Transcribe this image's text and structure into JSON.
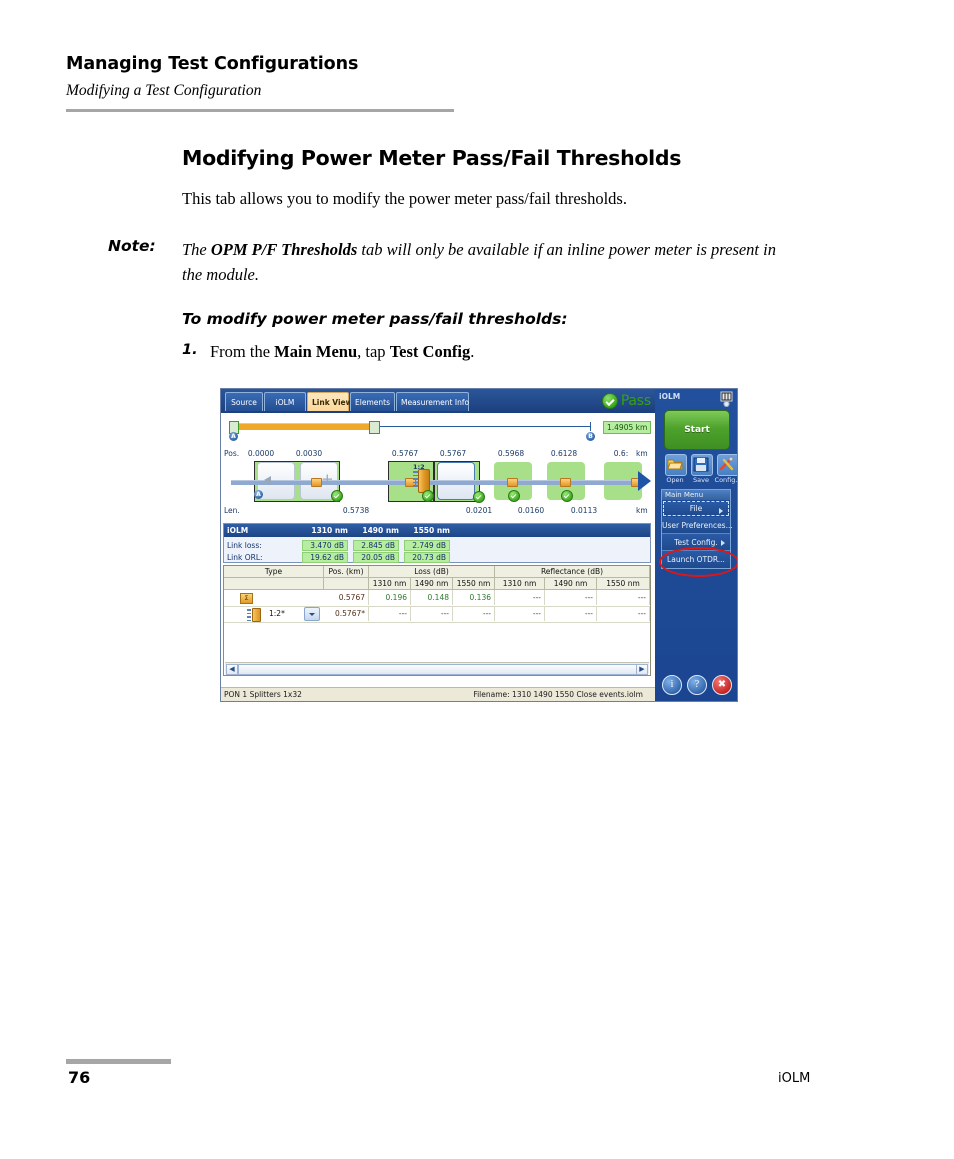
{
  "page": {
    "header_title": "Managing Test Configurations",
    "header_subtitle": "Modifying a Test Configuration",
    "section_title": "Modifying Power Meter Pass/Fail Thresholds",
    "intro_paragraph": "This tab allows you to modify the power meter pass/fail thresholds.",
    "note_label": "Note:",
    "note_text_pre": "The ",
    "note_text_bold": "OPM P/F Thresholds",
    "note_text_post": " tab will only be available if an inline power meter is present in the module.",
    "procedure_title": "To modify power meter pass/fail thresholds:",
    "step_number": "1.",
    "step_pre": "From the ",
    "step_bold1": "Main Menu",
    "step_mid": ", tap ",
    "step_bold2": "Test Config",
    "step_post": ".",
    "footer_page": "76",
    "footer_right": "iOLM"
  },
  "screenshot": {
    "tabs": [
      {
        "label": "Source",
        "active": false
      },
      {
        "label": "iOLM",
        "active": false
      },
      {
        "label": "Link View",
        "active": true
      },
      {
        "label": "Elements",
        "active": false
      },
      {
        "label": "Measurement Info",
        "active": false
      }
    ],
    "status": {
      "verdict": "Pass",
      "verdict_color": "#37a011"
    },
    "overview": {
      "distance_badge": "1.4905 km",
      "marker_a": "A",
      "marker_b": "B"
    },
    "linkview": {
      "pos_label": "Pos.",
      "len_label": "Len.",
      "unit_top": "km",
      "unit_bottom": "km",
      "positions": [
        "0.0000",
        "0.0030",
        "0.5767",
        "0.5767",
        "0.5968",
        "0.6128",
        "0.6:"
      ],
      "lengths": [
        "0.5738",
        "0.0201",
        "0.0160",
        "0.0113"
      ],
      "splitter_ratio": "1:2",
      "marker_a": "A"
    },
    "results": {
      "title": "iOLM",
      "wavelengths": [
        "1310 nm",
        "1490 nm",
        "1550 nm"
      ],
      "rows": [
        {
          "label": "Link loss:",
          "values": [
            "3.470 dB",
            "2.845 dB",
            "2.749 dB"
          ]
        },
        {
          "label": "Link ORL:",
          "values": [
            "19.62 dB",
            "20.05 dB",
            "20.73 dB"
          ]
        }
      ]
    },
    "table": {
      "group_headers": [
        "Type",
        "Pos. (km)",
        "Loss (dB)",
        "Reflectance (dB)"
      ],
      "sub_headers": [
        "1310 nm",
        "1490 nm",
        "1550 nm",
        "1310 nm",
        "1490 nm",
        "1550 nm"
      ],
      "rows": [
        {
          "icon": "event-icon",
          "type_label": "",
          "pos": "0.5767",
          "loss": [
            "0.196",
            "0.148",
            "0.136"
          ],
          "reflectance": [
            "---",
            "---",
            "---"
          ]
        },
        {
          "icon": "splitter-icon",
          "type_label": "1:2*",
          "pos": "0.5767*",
          "loss": [
            "---",
            "---",
            "---"
          ],
          "reflectance": [
            "---",
            "---",
            "---"
          ]
        }
      ],
      "scroll_left": "◀",
      "scroll_right": "▶"
    },
    "statusbar": {
      "left": "PON 1 Splitters 1x32",
      "right": "Filename: 1310 1490 1550 Close events.iolm"
    },
    "panel": {
      "title": "iOLM",
      "start_button": "Start",
      "tools": [
        {
          "label": "Open",
          "icon": "folder-open-icon"
        },
        {
          "label": "Save",
          "icon": "floppy-disk-icon"
        },
        {
          "label": "Config.",
          "icon": "tools-icon"
        }
      ],
      "main_menu_header": "Main Menu",
      "menu_items": [
        {
          "label": "File",
          "has_submenu": true,
          "selected": true
        },
        {
          "label": "User Preferences...",
          "has_submenu": false,
          "selected": false
        },
        {
          "label": "Test Config.",
          "has_submenu": true,
          "selected": false,
          "highlighted": true
        },
        {
          "label": "Launch OTDR...",
          "has_submenu": false,
          "selected": false
        }
      ],
      "bottom_buttons": [
        {
          "icon": "info-icon",
          "glyph": "i"
        },
        {
          "icon": "help-icon",
          "glyph": "?"
        },
        {
          "icon": "exit-icon",
          "glyph": "✖"
        }
      ]
    }
  }
}
